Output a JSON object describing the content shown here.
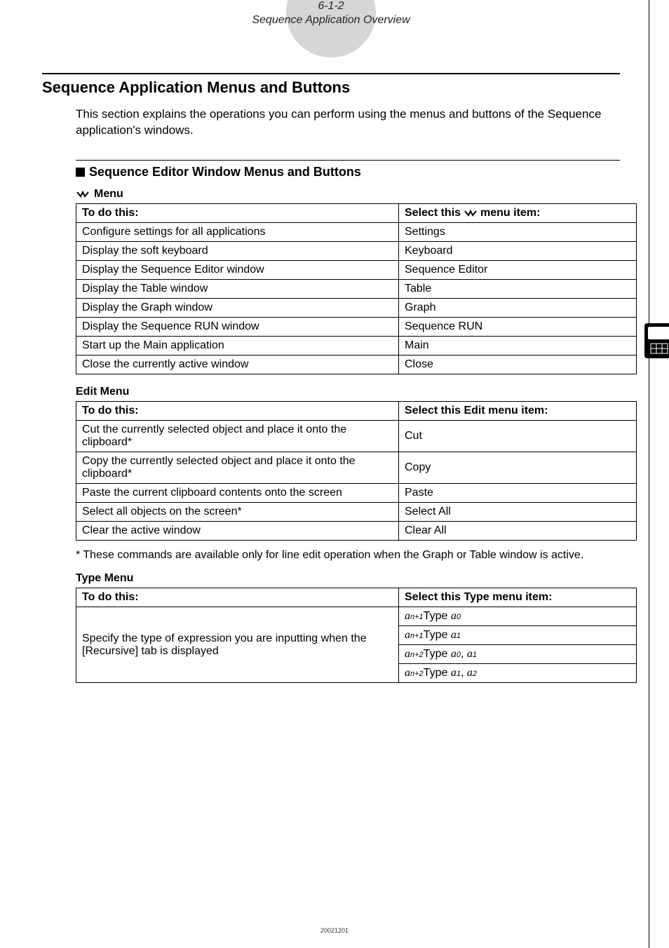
{
  "header": {
    "section_number": "6-1-2",
    "section_title": "Sequence Application Overview"
  },
  "main_heading": "Sequence Application Menus and Buttons",
  "intro_paragraph": "This section explains the operations you can perform using the menus and buttons of the Sequence application's windows.",
  "sub_heading": "Sequence Editor Window Menus and Buttons",
  "system_menu": {
    "label": "Menu",
    "header_left": "To do this:",
    "header_right_pre": "Select this ",
    "header_right_post": " menu item:",
    "rows": [
      {
        "left": "Configure settings for all applications",
        "right": "Settings"
      },
      {
        "left": "Display the soft keyboard",
        "right": "Keyboard"
      },
      {
        "left": "Display the Sequence Editor window",
        "right": "Sequence Editor"
      },
      {
        "left": "Display the Table window",
        "right": "Table"
      },
      {
        "left": "Display the Graph window",
        "right": "Graph"
      },
      {
        "left": "Display the Sequence RUN window",
        "right": "Sequence RUN"
      },
      {
        "left": "Start up the Main application",
        "right": "Main"
      },
      {
        "left": "Close the currently active window",
        "right": "Close"
      }
    ]
  },
  "edit_menu": {
    "label": "Edit Menu",
    "header_left": "To do this:",
    "header_right": "Select this Edit menu item:",
    "rows": [
      {
        "left": "Cut the currently selected object and place it onto the clipboard*",
        "right": "Cut"
      },
      {
        "left": "Copy the currently selected object and place it onto the clipboard*",
        "right": "Copy"
      },
      {
        "left": "Paste the current clipboard contents onto the screen",
        "right": "Paste"
      },
      {
        "left": "Select all objects on the screen*",
        "right": "Select All"
      },
      {
        "left": "Clear the active window",
        "right": "Clear All"
      }
    ]
  },
  "footnote": "* These commands are available only for line edit operation when the Graph or Table window is active.",
  "type_menu": {
    "label": "Type Menu",
    "header_left": "To do this:",
    "header_right": "Select this Type menu item:",
    "left_cell": "Specify the type of expression you are inputting when the [Recursive] tab is displayed",
    "rows_html": [
      {
        "a_prefix": "a",
        "idx1": "n+1",
        "mid": "Type ",
        "b_prefix": "a",
        "idx2": "0",
        "tail": ""
      },
      {
        "a_prefix": "a",
        "idx1": "n+1",
        "mid": "Type ",
        "b_prefix": "a",
        "idx2": "1",
        "tail": ""
      },
      {
        "a_prefix": "a",
        "idx1": "n+2",
        "mid": "Type ",
        "b_prefix": "a",
        "idx2": "0",
        "comma": ", ",
        "c_prefix": "a",
        "idx3": "1"
      },
      {
        "a_prefix": "a",
        "idx1": "n+2",
        "mid": "Type ",
        "b_prefix": "a",
        "idx2": "1",
        "comma": ", ",
        "c_prefix": "a",
        "idx3": "2"
      }
    ]
  },
  "footer_num": "20021201"
}
